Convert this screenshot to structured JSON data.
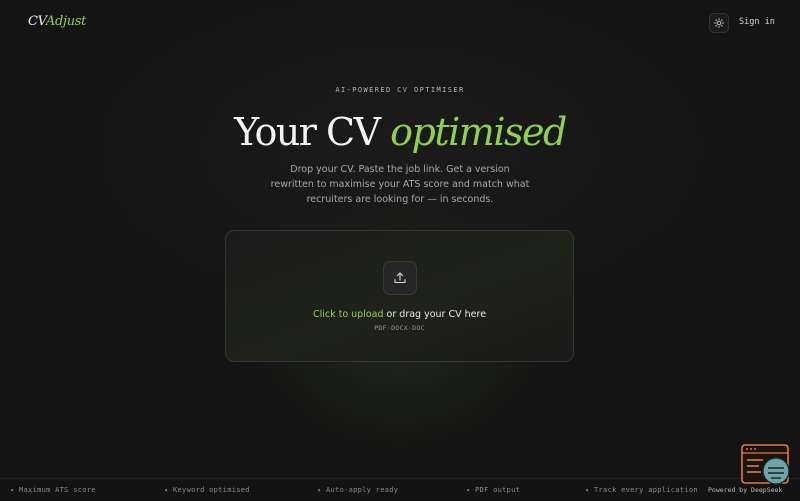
{
  "brand": {
    "logo_cv": "CV",
    "logo_adjust": "Adjust"
  },
  "header": {
    "sign_in": "Sign in",
    "theme_icon": "sun-icon"
  },
  "hero": {
    "eyebrow": "AI-POWERED CV OPTIMISER",
    "title_plain": "Your CV",
    "title_accent": "optimised",
    "subtitle": "Drop your CV. Paste the job link. Get a version rewritten to maximise your ATS score and match what recruiters are looking for — in seconds."
  },
  "upload": {
    "icon": "upload-icon",
    "click_label": "Click to upload",
    "drag_label": "or drag your CV here",
    "formats": "PDF·DOCX·DOC"
  },
  "features": [
    "✦ Maximum ATS score",
    "✦ Keyword optimised",
    "✦ Auto-apply ready",
    "✦ PDF output",
    "✦ Track every application"
  ],
  "footer": {
    "powered": "Powered by DeepSeek"
  },
  "colors": {
    "accent": "#8fd14f",
    "background": "#141414",
    "widget": "#e07b3c"
  }
}
